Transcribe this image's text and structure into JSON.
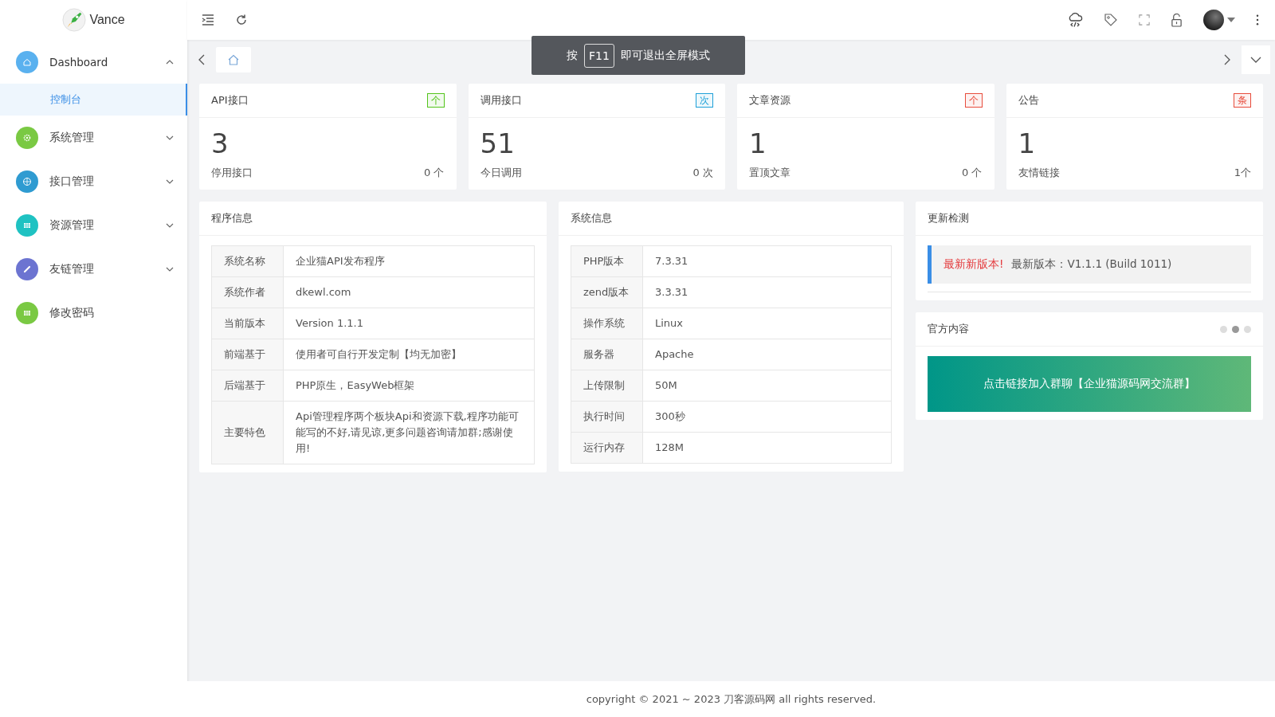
{
  "brand": {
    "name": "Vance"
  },
  "sidebar": {
    "items": [
      {
        "label": "Dashboard",
        "kind": "home",
        "color": "#5ab1ef",
        "has_children": true,
        "expanded": true,
        "children": [
          {
            "label": "控制台",
            "selected": true
          }
        ]
      },
      {
        "label": "系统管理",
        "kind": "gear",
        "color": "#7ac943",
        "has_children": true,
        "expanded": false
      },
      {
        "label": "接口管理",
        "kind": "globe",
        "color": "#2f9bd1",
        "has_children": true,
        "expanded": false
      },
      {
        "label": "资源管理",
        "kind": "grid",
        "color": "#1fc2c2",
        "has_children": true,
        "expanded": false
      },
      {
        "label": "友链管理",
        "kind": "link",
        "color": "#6c74d1",
        "has_children": true,
        "expanded": false
      },
      {
        "label": "修改密码",
        "kind": "grid",
        "color": "#7ac943",
        "has_children": false,
        "expanded": false
      }
    ]
  },
  "toast": {
    "before": "按",
    "key": "F11",
    "after": "即可退出全屏模式"
  },
  "stats": [
    {
      "title": "API接口",
      "tag": "个",
      "color": "#52c41a",
      "value": "3",
      "sub_label": "停用接口",
      "sub_value": "0 个"
    },
    {
      "title": "调用接口",
      "tag": "次",
      "color": "#1ea0d8",
      "value": "51",
      "sub_label": "今日调用",
      "sub_value": "0 次"
    },
    {
      "title": "文章资源",
      "tag": "个",
      "color": "#e74c3c",
      "value": "1",
      "sub_label": "置顶文章",
      "sub_value": "0 个"
    },
    {
      "title": "公告",
      "tag": "条",
      "color": "#e74c3c",
      "value": "1",
      "sub_label": "友情链接",
      "sub_value": "1个"
    }
  ],
  "program_info": {
    "title": "程序信息",
    "rows": [
      [
        "系统名称",
        "企业猫API发布程序"
      ],
      [
        "系统作者",
        "dkewl.com"
      ],
      [
        "当前版本",
        "Version 1.1.1"
      ],
      [
        "前端基于",
        "使用者可自行开发定制【均无加密】"
      ],
      [
        "后端基于",
        "PHP原生，EasyWeb框架"
      ],
      [
        "主要特色",
        "Api管理程序两个板块Api和资源下载,程序功能可能写的不好,请见谅,更多问题咨询请加群;感谢使用!"
      ]
    ]
  },
  "system_info": {
    "title": "系统信息",
    "rows": [
      [
        "PHP版本",
        "7.3.31"
      ],
      [
        "zend版本",
        "3.3.31"
      ],
      [
        "操作系统",
        "Linux"
      ],
      [
        "服务器",
        "Apache"
      ],
      [
        "上传限制",
        "50M"
      ],
      [
        "执行时间",
        "300秒"
      ],
      [
        "运行内存",
        "128M"
      ]
    ]
  },
  "update_check": {
    "title": "更新检测",
    "highlight": "最新新版本!",
    "text": "最新版本：V1.1.1 (Build 1011)"
  },
  "official": {
    "title": "官方内容",
    "dots": [
      {
        "selected": false
      },
      {
        "selected": true
      },
      {
        "selected": false
      }
    ],
    "banner": "点击链接加入群聊【企业猫源码网交流群】"
  },
  "footer": "copyright © 2021 ~ 2023 刀客源码网 all rights reserved."
}
